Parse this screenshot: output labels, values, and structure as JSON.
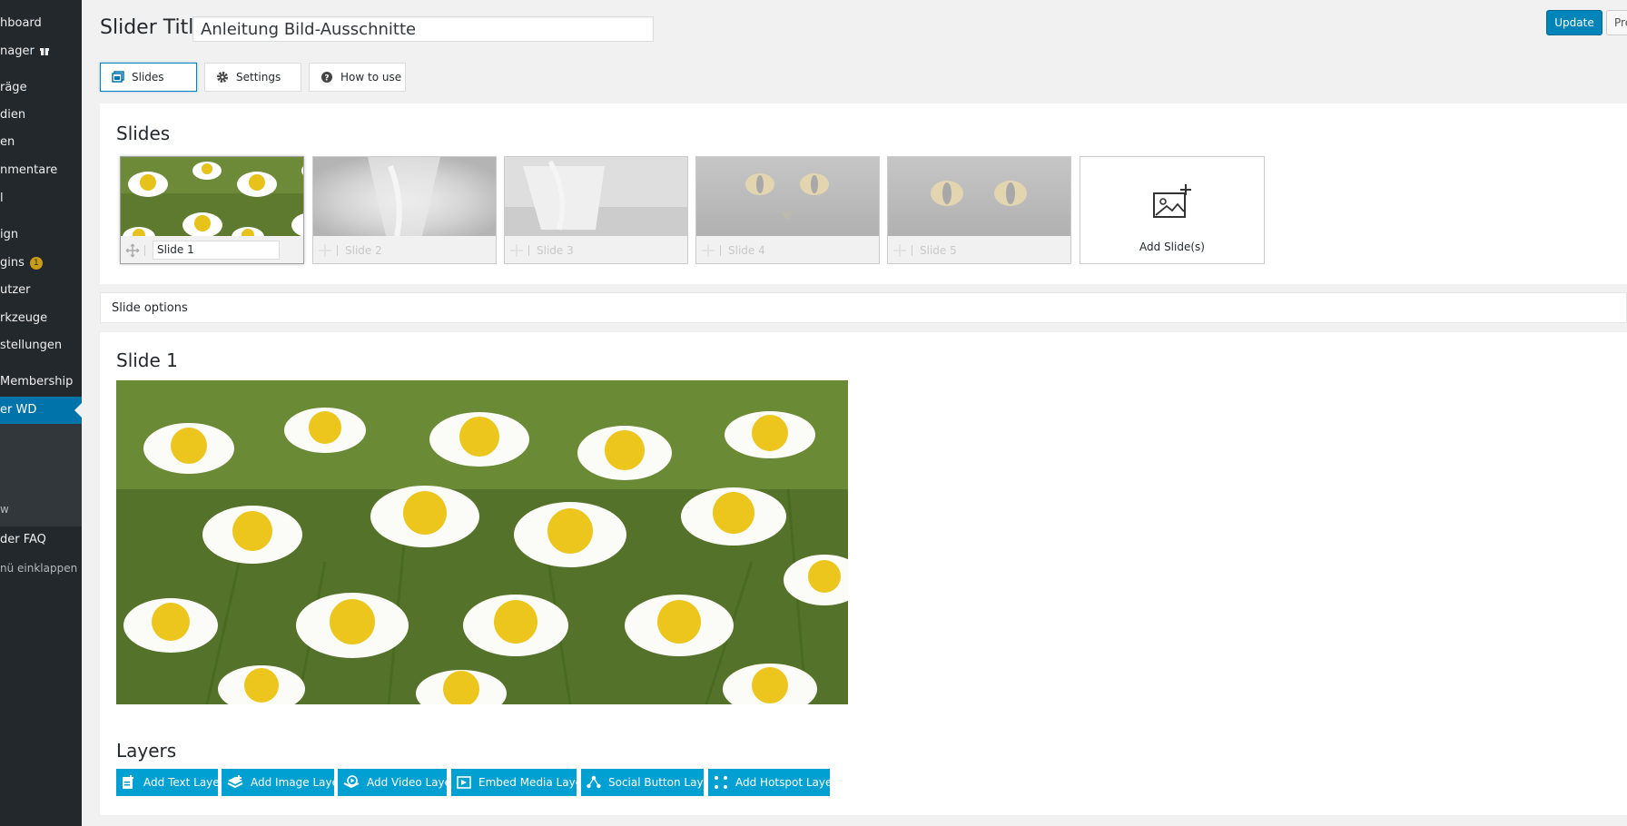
{
  "sidebar": {
    "items": [
      {
        "label": "hboard"
      },
      {
        "label": "nager"
      },
      {
        "label": "räge"
      },
      {
        "label": "dien"
      },
      {
        "label": "en"
      },
      {
        "label": "nmentare"
      },
      {
        "label": "l"
      },
      {
        "label": "ign"
      },
      {
        "label": "gins",
        "badge": "1"
      },
      {
        "label": "utzer"
      },
      {
        "label": "rkzeuge"
      },
      {
        "label": "stellungen"
      },
      {
        "label": "Membership"
      },
      {
        "label": "er WD",
        "active": true
      },
      {
        "label": "w"
      },
      {
        "label": "der FAQ"
      },
      {
        "label": "nü einklappen"
      }
    ]
  },
  "header": {
    "title_label": "Slider Title",
    "title_value": "Anleitung Bild-Ausschnitte",
    "update_label": "Update",
    "preview_label": "Pre"
  },
  "tabs": [
    {
      "label": "Slides",
      "icon": "slides-icon",
      "active": true
    },
    {
      "label": "Settings",
      "icon": "gear-icon"
    },
    {
      "label": "How to use",
      "icon": "question-icon"
    }
  ],
  "slides_panel": {
    "heading": "Slides",
    "slides": [
      {
        "title": "Slide 1",
        "image": "chamomile-flowers"
      },
      {
        "title": "Slide 2",
        "image": "water-glass"
      },
      {
        "title": "Slide 3",
        "image": "water-glass"
      },
      {
        "title": "Slide 4",
        "image": "cat-face"
      },
      {
        "title": "Slide 5",
        "image": "cat-face"
      }
    ],
    "add_label": "Add Slide(s)"
  },
  "slide_options": {
    "label": "Slide options"
  },
  "current_slide": {
    "heading": "Slide 1",
    "image": "chamomile-flowers"
  },
  "layers": {
    "heading": "Layers",
    "buttons": [
      {
        "label": "Add Text Layer",
        "icon": "text-layer-icon"
      },
      {
        "label": "Add Image Layer",
        "icon": "image-layer-icon"
      },
      {
        "label": "Add Video Layer",
        "icon": "video-layer-icon"
      },
      {
        "label": "Embed Media Layer",
        "icon": "embed-media-icon"
      },
      {
        "label": "Social Button Layer",
        "icon": "social-share-icon"
      },
      {
        "label": "Add Hotspot Layer",
        "icon": "hotspot-icon"
      }
    ]
  },
  "colors": {
    "sidebar_bg": "#23282d",
    "sidebar_active": "#0073aa",
    "primary_button": "#0085ba",
    "layer_button": "#00a0d2",
    "page_bg": "#f1f1f1"
  }
}
